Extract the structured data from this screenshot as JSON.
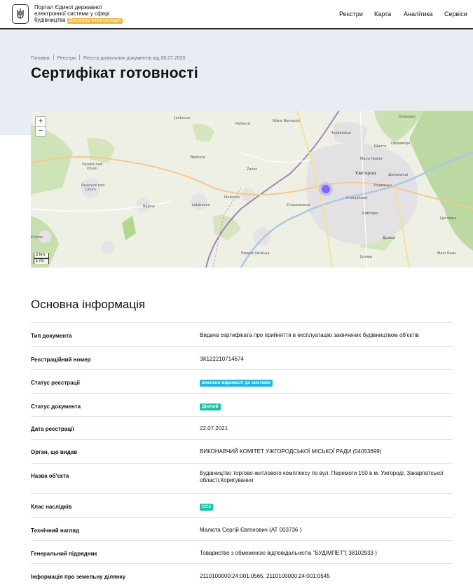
{
  "header": {
    "brand_line1": "Портал Єдиної державної",
    "brand_line2": "електронної системи у сфері",
    "brand_line3": "будівництва",
    "beta_badge": "Дослідна експлуатація",
    "nav": [
      "Реєстри",
      "Карта",
      "Аналітика",
      "Сервіси"
    ]
  },
  "breadcrumb": [
    "Головна",
    "Реєстри",
    "Реєстр дозвільних документів від 06.07.2020"
  ],
  "page_title": "Сертифікат готовності",
  "map": {
    "zoom_in": "+",
    "zoom_out": "−",
    "scale_km": "2 km",
    "scale_mi": "1 mi",
    "place_labels": [
      "Jenkovce",
      "Nižné Nemecké",
      "Червениця",
      "Концово",
      "Оноковці",
      "Шахта",
      "Мала Праля",
      "Оріховиця",
      "Vysoká nad Uhom",
      "Pavlovce nad Uhom",
      "Bajany",
      "Bežovce",
      "Zahor",
      "Palfovce",
      "Lekárovce",
      "Pinkovce",
      "Ужгород",
      "Доманинці",
      "Радванка",
      "Сторожниця",
      "Станційний",
      "Кибляри",
      "Дравці",
      "Цеглівка",
      "Малі Лази",
      "Ірлява",
      "Нижня Хмільна",
      "Kristov"
    ]
  },
  "section_title": "Основна інформація",
  "rows": [
    {
      "key": "Тип документа",
      "value": "Видача сертифіката про прийняття в експлуатацію закінчених будівництвом об'єктів"
    },
    {
      "key": "Реєстраційний номер",
      "value": "ЗК122210714674"
    },
    {
      "key": "Статус реєстрації",
      "badge": "внесено відомості до системи",
      "badge_color": "#1fb7e0"
    },
    {
      "key": "Статус документа",
      "badge": "Діючий",
      "badge_color": "#17c3a2"
    },
    {
      "key": "Дата реєстрації",
      "value": "22.07.2021"
    },
    {
      "key": "Орган, що видав",
      "value": "ВИКОНАВЧИЙ КОМІТЕТ УЖГОРОДСЬКОЇ МІСЬКОЇ РАДИ (04053699)"
    },
    {
      "key": "Назва об'єкта",
      "value": "Будівництво торгово-житлового комплексу по вул. Перемоги 150 в м. Ужгороді, Закарпатської області.Коригування"
    },
    {
      "key": "Клас наслідків",
      "badge": "СС2",
      "badge_color": "#17c3a2"
    },
    {
      "key": "Технічний нагляд",
      "value": "Малюта Сергій Євгенович (АТ 003736 )"
    },
    {
      "key": "Генеральний підрядник",
      "value": "Товариство з обмеженою відповідальністю \"БУДІМПЕТ\"( 38102933 )"
    },
    {
      "key": "Інформація про земельну ділянку",
      "value": "2110100000:24:001:0565, 2110100000:24:001:0545"
    }
  ],
  "colors": {
    "accent_badge": "#f2b63c",
    "hero_bg": "#e7edf3",
    "marker": "#7b5cff"
  }
}
